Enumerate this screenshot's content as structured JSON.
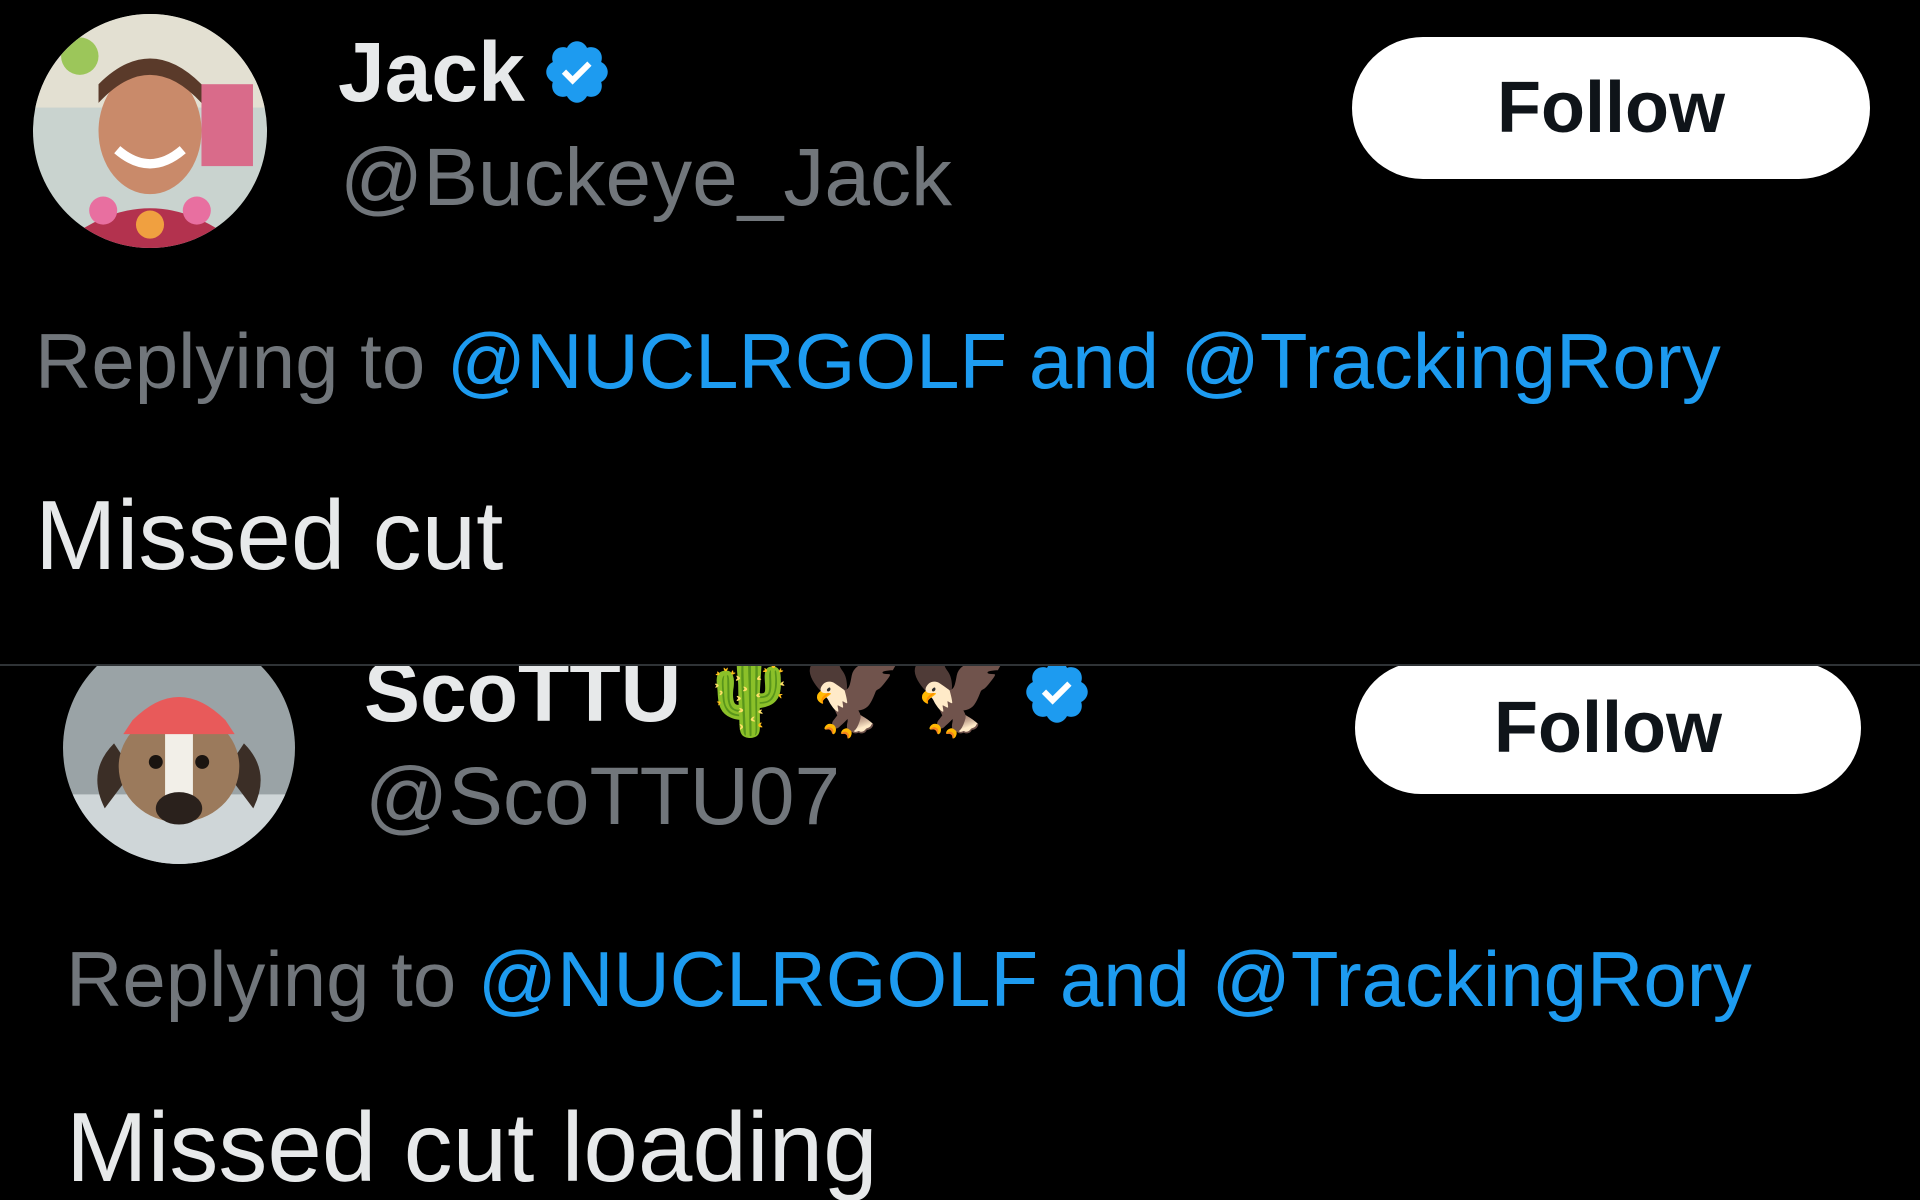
{
  "colors": {
    "background": "#000000",
    "primary_text": "#e7e9ea",
    "secondary_text": "#71767b",
    "link": "#1d9bf0",
    "verified_badge": "#1d9bf0",
    "follow_button_bg": "#ffffff",
    "follow_button_text": "#0f1419"
  },
  "tweets": [
    {
      "avatar_icon": "user-avatar-photo",
      "display_name": "Jack",
      "verified": true,
      "handle": "@Buckeye_Jack",
      "follow_label": "Follow",
      "replying_prefix": "Replying to",
      "mention_1": "@NUCLRGOLF",
      "replying_and": "and",
      "mention_2": "@TrackingRory",
      "text": "Missed cut"
    },
    {
      "avatar_icon": "dog-avatar-photo",
      "display_name": "ScoTTU",
      "name_emojis": "🌵🦅🦅",
      "verified": true,
      "handle": "@ScoTTU07",
      "follow_label": "Follow",
      "replying_prefix": "Replying to",
      "mention_1": "@NUCLRGOLF",
      "replying_and": "and",
      "mention_2": "@TrackingRory",
      "text": "Missed cut loading"
    }
  ]
}
